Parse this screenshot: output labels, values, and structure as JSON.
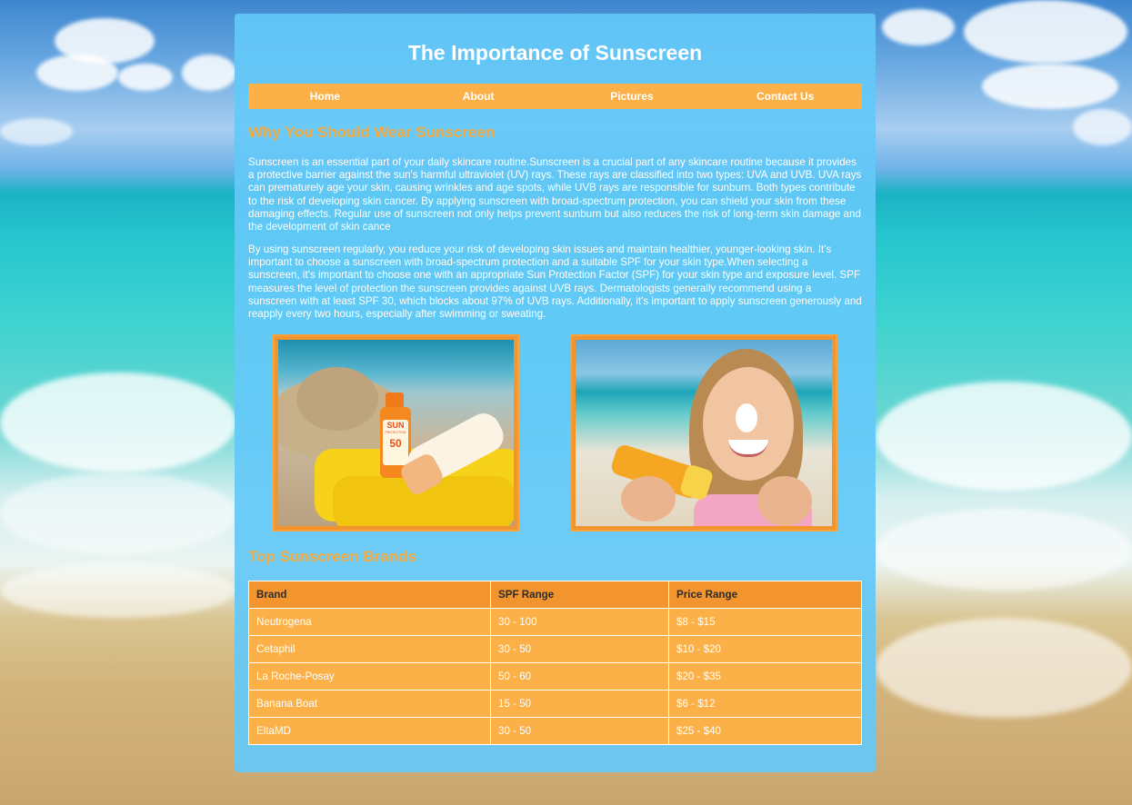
{
  "page": {
    "title": "The Importance of Sunscreen"
  },
  "nav": {
    "items": [
      {
        "label": "Home"
      },
      {
        "label": "About"
      },
      {
        "label": "Pictures"
      },
      {
        "label": "Contact Us"
      }
    ]
  },
  "why": {
    "heading": "Why You Should Wear Sunscreen",
    "paragraph1": "Sunscreen is an essential part of your daily skincare routine.Sunscreen is a crucial part of any skincare routine because it provides a protective barrier against the sun's harmful ultraviolet (UV) rays. These rays are classified into two types: UVA and UVB. UVA rays can prematurely age your skin, causing wrinkles and age spots, while UVB rays are responsible for sunburn. Both types contribute to the risk of developing skin cancer. By applying sunscreen with broad-spectrum protection, you can shield your skin from these damaging effects. Regular use of sunscreen not only helps prevent sunburn but also reduces the risk of long-term skin damage and the development of skin cance",
    "paragraph2": "By using sunscreen regularly, you reduce your risk of developing skin issues and maintain healthier, younger-looking skin. It's important to choose a sunscreen with broad-spectrum protection and a suitable SPF for your skin type.When selecting a sunscreen, it's important to choose one with an appropriate Sun Protection Factor (SPF) for your skin type and exposure level. SPF measures the level of protection the sunscreen provides against UVB rays. Dermatologists generally recommend using a sunscreen with at least SPF 30, which blocks about 97% of UVB rays. Additionally, it's important to apply sunscreen generously and reapply every two hours, especially after swimming or sweating."
  },
  "photos": {
    "bottle_text_sun": "SUN",
    "bottle_text_protection": "PROTECTION",
    "bottle_text_spf": "50"
  },
  "brands": {
    "heading": "Top Sunscreen Brands",
    "columns": [
      "Brand",
      "SPF Range",
      "Price Range"
    ],
    "rows": [
      [
        "Neutrogena",
        "30 - 100",
        "$8 - $15"
      ],
      [
        "Cetaphil",
        "30 - 50",
        "$10 - $20"
      ],
      [
        "La Roche-Posay",
        "50 - 60",
        "$20 - $35"
      ],
      [
        "Banana Boat",
        "15 - 50",
        "$6 - $12"
      ],
      [
        "EltaMD",
        "30 - 50",
        "$25 - $40"
      ]
    ]
  },
  "colors": {
    "accent_orange": "#fbb147",
    "header_orange": "#f3952f",
    "heading_orange": "#f5a941",
    "panel_blue": "#64c8f8"
  }
}
